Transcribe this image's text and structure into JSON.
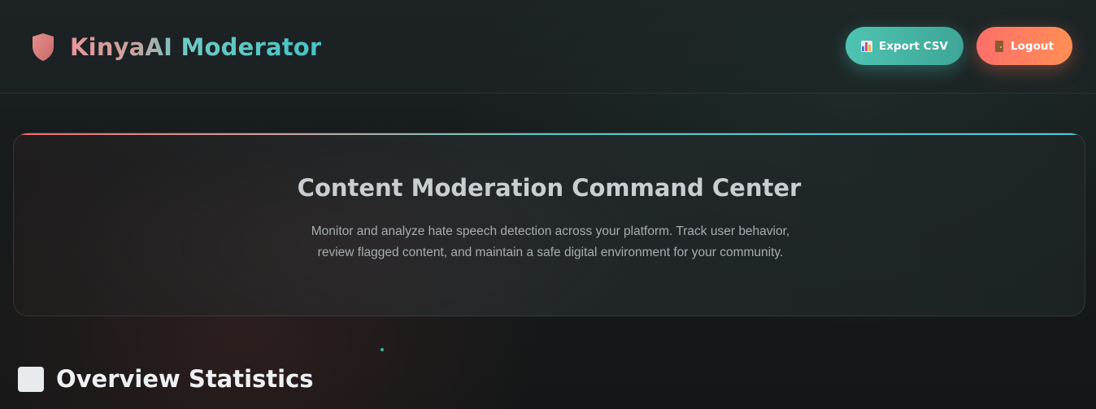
{
  "header": {
    "brand_title": "KinyaAI Moderator",
    "brand_icon": "shield-icon",
    "export_label": "Export CSV",
    "export_icon": "bar-chart-icon",
    "logout_label": "Logout",
    "logout_icon": "door-icon"
  },
  "hero": {
    "title": "Content Moderation Command Center",
    "description": "Monitor and analyze hate speech detection across your platform. Track user behavior, review flagged content, and maintain a safe digital environment for your community."
  },
  "overview": {
    "title": "Overview Statistics",
    "icon": "square-icon"
  },
  "colors": {
    "export_button": "#4ec3b2",
    "logout_button": "#ff7a62",
    "brand_gradient_start": "#e8969a",
    "brand_gradient_end": "#45c3c4"
  }
}
